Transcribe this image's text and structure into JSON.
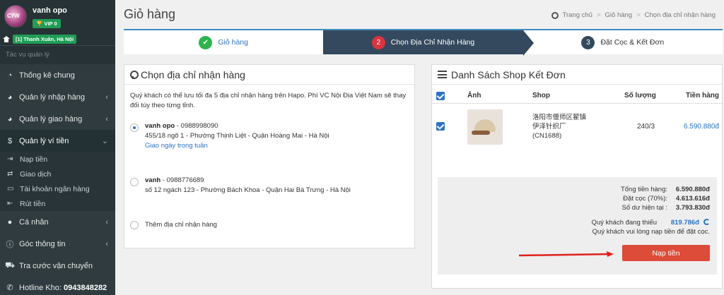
{
  "sidebar": {
    "username": "vanh opo",
    "vip": "VIP 0",
    "location": "[1] Thanh Xuân, Hà Nội",
    "search_placeholder": "Tác vụ quản lý",
    "items": [
      {
        "label": "Thống kê chung",
        "icon": "dashboard-icon"
      },
      {
        "label": "Quản lý nhập hàng",
        "icon": "pie-icon"
      },
      {
        "label": "Quản lý giao hàng",
        "icon": "pie-icon"
      },
      {
        "label": "Quản lý ví tiền",
        "icon": "dollar-icon"
      },
      {
        "label": "Cá nhân",
        "icon": "user-icon"
      },
      {
        "label": "Góc thông tin",
        "icon": "info-icon"
      },
      {
        "label": "Tra cước vận chuyển",
        "icon": "truck-icon"
      }
    ],
    "sub_items": [
      {
        "label": "Nạp tiền"
      },
      {
        "label": "Giao dịch"
      },
      {
        "label": "Tài khoản ngân hàng"
      },
      {
        "label": "Rút tiền"
      }
    ],
    "hotline_label": "Hotline Kho:",
    "hotline_number": "0943848282"
  },
  "header": {
    "title": "Giỏ hàng",
    "breadcrumb": [
      "Trang chủ",
      "Giỏ hàng",
      "Chọn địa chỉ nhận hàng"
    ]
  },
  "steps": [
    {
      "num": "✔",
      "label": "Giỏ hàng"
    },
    {
      "num": "2",
      "label": "Chọn Địa Chỉ Nhận Hàng"
    },
    {
      "num": "3",
      "label": "Đặt Cọc & Kết Đơn"
    }
  ],
  "address_panel": {
    "title": "Chọn địa chỉ nhận hàng",
    "note": "Quý khách có thể lưu tối đa 5 địa chỉ nhận hàng trên Hapo. Phí VC Nội Địa Việt Nam sẽ thay đổi tùy theo từng tỉnh.",
    "addresses": [
      {
        "name": "vanh opo",
        "phone": " - 0988998090",
        "address": "455/18 ngõ 1 - Phường Thịnh Liệt - Quận Hoàng Mai - Hà Nội",
        "note": "Giao ngày trong tuần"
      },
      {
        "name": "vanh",
        "phone": " - 0988776689",
        "address": "số 12 ngách 123 - Phường Bách Khoa - Quận Hai Bà Trưng - Hà Nội",
        "note": ""
      }
    ],
    "add_label": "Thêm địa chỉ nhận hàng"
  },
  "shop_panel": {
    "title": "Danh Sách Shop Kết Đơn",
    "columns": [
      "Ảnh",
      "Shop",
      "Số lượng",
      "Tiền hàng"
    ],
    "row": {
      "shop_line1": "洛阳市偃师区翟镇",
      "shop_line2": "伊泽针织厂",
      "shop_line3": "(CN1688)",
      "qty": "240/3",
      "amount": "6.590.880đ"
    },
    "summary": {
      "total_label": "Tổng tiền hàng:",
      "total_value": "6.590.880đ",
      "deposit_label": "Đặt cọc (70%):",
      "deposit_value": "4.613.616đ",
      "balance_label": "Số dư hiện tại :",
      "balance_value": "3.793.830đ",
      "owe_label": "Quý khách đang thiếu",
      "owe_value": "819.786đ",
      "topup_note": "Quý khách vui lòng nạp tiền để đặt cọc."
    },
    "pay_button": "Nạp tiền"
  },
  "colors": {
    "accent": "#3c8dbc",
    "danger": "#dd4b39",
    "success": "#2eb34e",
    "link": "#2a73c5"
  }
}
